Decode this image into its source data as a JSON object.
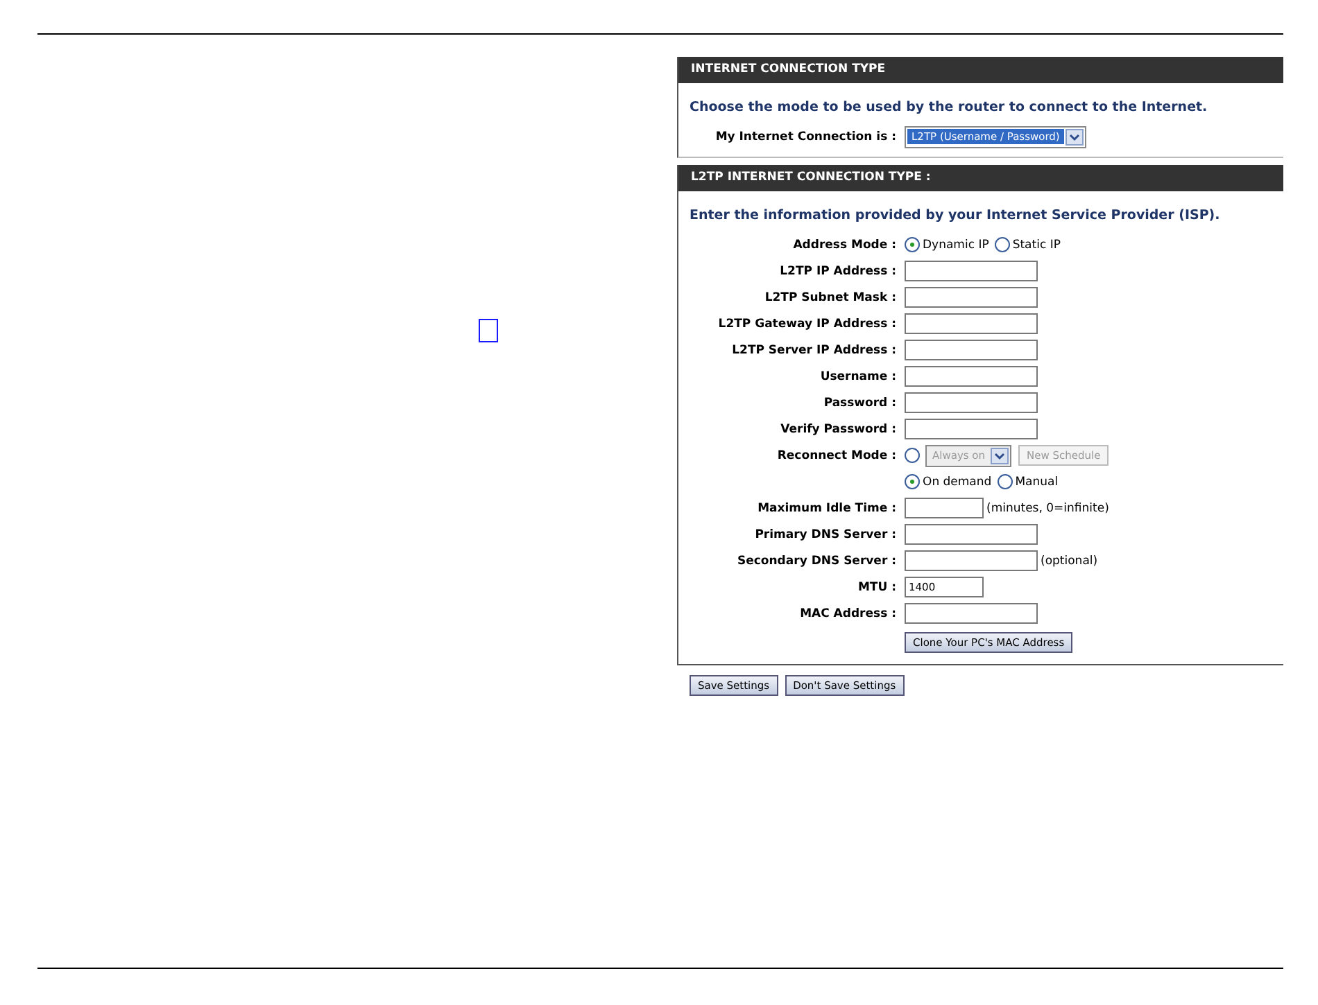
{
  "marker": {
    "kind": "outline-square"
  },
  "connection_type": {
    "title": "INTERNET CONNECTION TYPE",
    "description": "Choose the mode to be used by the router to connect to the Internet.",
    "label": "My Internet Connection is :",
    "select": "L2TP (Username / Password)"
  },
  "l2tp": {
    "title": "L2TP INTERNET CONNECTION TYPE :",
    "description": "Enter the information provided by your Internet Service Provider (ISP).",
    "rows": [
      {
        "kind": "radio",
        "label": "Address Mode :",
        "options": [
          {
            "label": "Dynamic IP",
            "selected": true
          },
          {
            "label": "Static IP",
            "selected": false
          }
        ]
      },
      {
        "kind": "text",
        "label": "L2TP IP Address :"
      },
      {
        "kind": "text",
        "label": "L2TP Subnet Mask :"
      },
      {
        "kind": "text",
        "label": "L2TP Gateway IP Address :"
      },
      {
        "kind": "text",
        "label": "L2TP Server IP Address :"
      },
      {
        "kind": "text",
        "label": "Username :"
      },
      {
        "kind": "text",
        "label": "Password :"
      },
      {
        "kind": "text",
        "label": "Verify Password :"
      },
      {
        "kind": "reconnect",
        "label": "Reconnect Mode :",
        "selected": false,
        "select": "Always on",
        "button": "New Schedule",
        "disabled": true
      },
      {
        "kind": "radio",
        "options": [
          {
            "label": "On demand",
            "selected": true
          },
          {
            "label": "Manual",
            "selected": false
          }
        ]
      },
      {
        "kind": "short",
        "label": "Maximum Idle Time :",
        "suffix": "(minutes, 0=infinite)"
      },
      {
        "kind": "text",
        "label": "Primary DNS Server :"
      },
      {
        "kind": "text",
        "label": "Secondary DNS Server :",
        "suffix": "(optional)"
      },
      {
        "kind": "short",
        "label": "MTU :",
        "value": "1400"
      },
      {
        "kind": "text",
        "label": "MAC Address :"
      },
      {
        "kind": "button",
        "button": "Clone Your PC's MAC Address"
      }
    ]
  },
  "buttons": [
    "Save Settings",
    "Don't Save Settings"
  ]
}
